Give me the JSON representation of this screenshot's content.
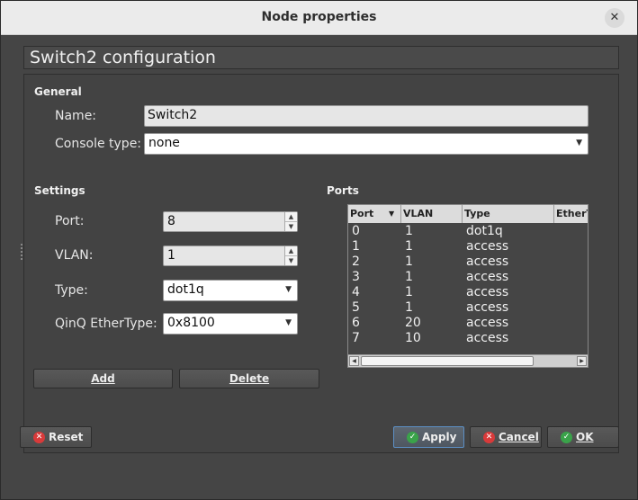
{
  "window": {
    "title": "Node properties",
    "close_glyph": "✕"
  },
  "header": {
    "title": "Switch2 configuration"
  },
  "general": {
    "section_title": "General",
    "name_label": "Name:",
    "name_value": "Switch2",
    "console_label": "Console type:",
    "console_value": "none"
  },
  "settings": {
    "section_title": "Settings",
    "port_label": "Port:",
    "port_value": "8",
    "vlan_label": "VLAN:",
    "vlan_value": "1",
    "type_label": "Type:",
    "type_value": "dot1q",
    "qinq_label": "QinQ EtherType:",
    "qinq_value": "0x8100",
    "add_label": "Add",
    "delete_label": "Delete"
  },
  "ports": {
    "section_title": "Ports",
    "columns": [
      "Port",
      "VLAN",
      "Type",
      "EtherTy"
    ],
    "rows": [
      [
        "0",
        "1",
        "dot1q"
      ],
      [
        "1",
        "1",
        "access"
      ],
      [
        "2",
        "1",
        "access"
      ],
      [
        "3",
        "1",
        "access"
      ],
      [
        "4",
        "1",
        "access"
      ],
      [
        "5",
        "1",
        "access"
      ],
      [
        "6",
        "20",
        "access"
      ],
      [
        "7",
        "10",
        "access"
      ]
    ]
  },
  "footer": {
    "reset_label": "Reset",
    "apply_label": "Apply",
    "cancel_label": "Cancel",
    "ok_label": "OK"
  },
  "icons": {
    "close": "close-icon",
    "reset": "cancel-circle-icon",
    "apply": "check-circle-icon",
    "cancel": "cancel-circle-icon",
    "ok": "check-circle-icon"
  },
  "colors": {
    "reset_red": "#d93a3a",
    "ok_green": "#3aa34a"
  }
}
